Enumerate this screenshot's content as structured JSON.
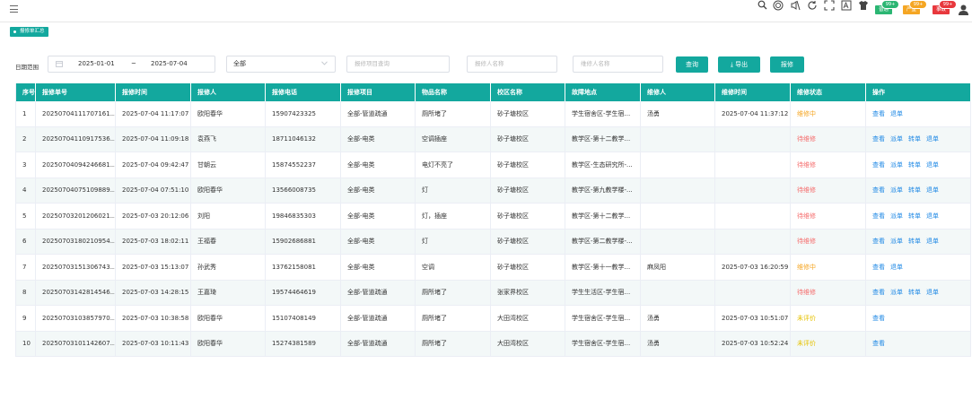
{
  "header": {
    "menu_icon": "hamburger-icon",
    "tools": [
      "search-icon",
      "help-circle-icon",
      "mute-icon",
      "refresh-icon",
      "fullscreen-icon",
      "font-size-icon",
      "shirt-icon"
    ],
    "tags": [
      {
        "label": "普通",
        "badge": "99+",
        "color": "#2bb673",
        "badge_color": "#2bb673"
      },
      {
        "label": "严重",
        "badge": "99+",
        "color": "#f5a623",
        "badge_color": "#f5a623"
      },
      {
        "label": "事故",
        "badge": "99+",
        "color": "#e8383d",
        "badge_color": "#e8383d"
      }
    ],
    "avatar_icon": "user-icon"
  },
  "page_tab": {
    "label": "报修单汇总"
  },
  "filters": {
    "date_label": "日期范围",
    "date_start": "2025-01-01",
    "date_sep": "~",
    "date_end": "2025-07-04",
    "select_value": "全部",
    "project_placeholder": "报修项目查询",
    "reporter_placeholder": "报修人名称",
    "repairer_placeholder": "维修人名称",
    "query_btn": "查询",
    "export_btn": "导出",
    "repair_btn": "报修"
  },
  "table": {
    "columns": [
      "序号",
      "报修单号",
      "报修时间",
      "报修人",
      "报修电话",
      "报修项目",
      "物品名称",
      "校区名称",
      "故障地点",
      "维修人",
      "维修时间",
      "维修状态",
      "操作"
    ],
    "rows": [
      {
        "no": "1",
        "order": "20250704111707161...",
        "time": "2025-07-04 11:17:07",
        "reporter": "欧阳春华",
        "phone": "15907423325",
        "project": "全部-管道疏通",
        "item": "厕所堵了",
        "campus": "砂子塘校区",
        "location": "学生宿舍区-学生宿...",
        "repairer": "汤勇",
        "repair_time": "2025-07-04 11:37:12",
        "status": "维修中",
        "status_color": "orange",
        "ops": [
          "查看",
          "退单"
        ]
      },
      {
        "no": "2",
        "order": "20250704110917536...",
        "time": "2025-07-04 11:09:18",
        "reporter": "袁燕飞",
        "phone": "18711046132",
        "project": "全部-电类",
        "item": "空调插座",
        "campus": "砂子塘校区",
        "location": "教学区-第十二教学...",
        "repairer": "",
        "repair_time": "",
        "status": "待维修",
        "status_color": "red",
        "ops": [
          "查看",
          "派单",
          "转单",
          "退单"
        ]
      },
      {
        "no": "3",
        "order": "20250704094246681...",
        "time": "2025-07-04 09:42:47",
        "reporter": "甘朝云",
        "phone": "15874552237",
        "project": "全部-电类",
        "item": "电灯不亮了",
        "campus": "砂子塘校区",
        "location": "教学区-生态研究所-...",
        "repairer": "",
        "repair_time": "",
        "status": "待维修",
        "status_color": "red",
        "ops": [
          "查看",
          "派单",
          "转单",
          "退单"
        ]
      },
      {
        "no": "4",
        "order": "20250704075109889...",
        "time": "2025-07-04 07:51:10",
        "reporter": "欧阳春华",
        "phone": "13566008735",
        "project": "全部-电类",
        "item": "灯",
        "campus": "砂子塘校区",
        "location": "教学区-第九教学楼-...",
        "repairer": "",
        "repair_time": "",
        "status": "待维修",
        "status_color": "red",
        "ops": [
          "查看",
          "派单",
          "转单",
          "退单"
        ]
      },
      {
        "no": "5",
        "order": "20250703201206021...",
        "time": "2025-07-03 20:12:06",
        "reporter": "刘阳",
        "phone": "19846835303",
        "project": "全部-电类",
        "item": "灯，插座",
        "campus": "砂子塘校区",
        "location": "教学区-第十二教学...",
        "repairer": "",
        "repair_time": "",
        "status": "待维修",
        "status_color": "red",
        "ops": [
          "查看",
          "派单",
          "转单",
          "退单"
        ]
      },
      {
        "no": "6",
        "order": "20250703180210954...",
        "time": "2025-07-03 18:02:11",
        "reporter": "王福春",
        "phone": "15902686881",
        "project": "全部-电类",
        "item": "灯",
        "campus": "砂子塘校区",
        "location": "教学区-第二教学楼-...",
        "repairer": "",
        "repair_time": "",
        "status": "待维修",
        "status_color": "red",
        "ops": [
          "查看",
          "派单",
          "转单",
          "退单"
        ]
      },
      {
        "no": "7",
        "order": "20250703151306743...",
        "time": "2025-07-03 15:13:07",
        "reporter": "孙武秀",
        "phone": "13762158081",
        "project": "全部-电类",
        "item": "空调",
        "campus": "砂子塘校区",
        "location": "教学区-第十一教学...",
        "repairer": "麻凤阳",
        "repair_time": "2025-07-03 16:20:59",
        "status": "维修中",
        "status_color": "orange",
        "ops": [
          "查看",
          "退单"
        ]
      },
      {
        "no": "8",
        "order": "20250703142814546...",
        "time": "2025-07-03 14:28:15",
        "reporter": "王嘉琦",
        "phone": "19574464619",
        "project": "全部-管道疏通",
        "item": "厕所堵了",
        "campus": "张家界校区",
        "location": "学生生活区-学生宿...",
        "repairer": "",
        "repair_time": "",
        "status": "待维修",
        "status_color": "red",
        "ops": [
          "查看",
          "派单",
          "转单",
          "退单"
        ]
      },
      {
        "no": "9",
        "order": "20250703103857970...",
        "time": "2025-07-03 10:38:58",
        "reporter": "欧阳春华",
        "phone": "15107408149",
        "project": "全部-管道疏通",
        "item": "厕所堵了",
        "campus": "大田湾校区",
        "location": "学生宿舍区-学生宿...",
        "repairer": "汤勇",
        "repair_time": "2025-07-03 10:51:07",
        "status": "未评价",
        "status_color": "yellow",
        "ops": [
          "查看"
        ]
      },
      {
        "no": "10",
        "order": "20250703101142607...",
        "time": "2025-07-03 10:11:43",
        "reporter": "欧阳春华",
        "phone": "15274381589",
        "project": "全部-管道疏通",
        "item": "厕所堵了",
        "campus": "大田湾校区",
        "location": "学生宿舍区-学生宿...",
        "repairer": "汤勇",
        "repair_time": "2025-07-03 10:52:24",
        "status": "未评价",
        "status_color": "yellow",
        "ops": [
          "查看"
        ]
      }
    ]
  }
}
